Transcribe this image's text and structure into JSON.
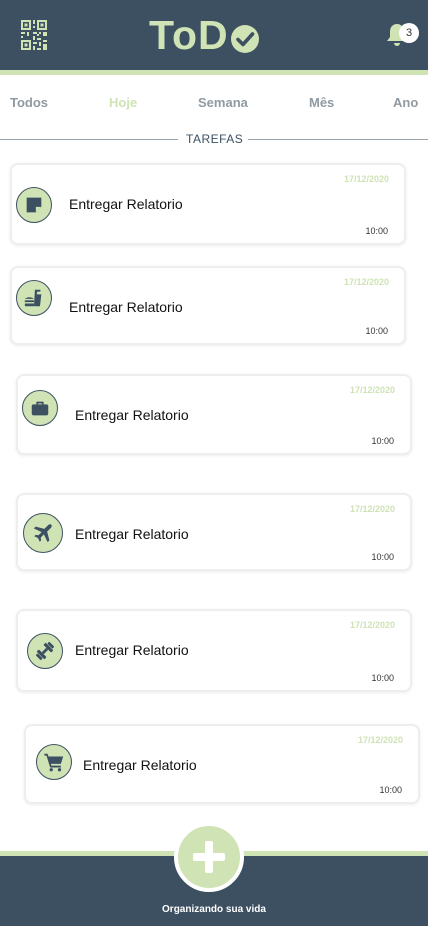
{
  "header": {
    "logo_text": "ToD",
    "notification_count": "3",
    "qr_icon": "qr-code-icon",
    "bell_icon": "bell-icon",
    "check_icon": "check-circle-icon"
  },
  "tabs": [
    {
      "label": "Todos",
      "active": false
    },
    {
      "label": "Hoje",
      "active": true
    },
    {
      "label": "Semana",
      "active": false
    },
    {
      "label": "Mês",
      "active": false
    },
    {
      "label": "Ano",
      "active": false
    }
  ],
  "section": {
    "label": "TAREFAS"
  },
  "tasks": [
    {
      "title": "Entregar Relatorio",
      "date": "17/12/2020",
      "time": "10:00",
      "icon": "note-icon"
    },
    {
      "title": "Entregar Relatorio",
      "date": "17/12/2020",
      "time": "10:00",
      "icon": "food-drink-icon"
    },
    {
      "title": "Entregar Relatorio",
      "date": "17/12/2020",
      "time": "10:00",
      "icon": "briefcase-icon"
    },
    {
      "title": "Entregar Relatorio",
      "date": "17/12/2020",
      "time": "10:00",
      "icon": "airplane-icon"
    },
    {
      "title": "Entregar Relatorio",
      "date": "17/12/2020",
      "time": "10:00",
      "icon": "dumbbell-icon"
    },
    {
      "title": "Entregar Relatorio",
      "date": "17/12/2020",
      "time": "10:00",
      "icon": "shopping-cart-icon"
    }
  ],
  "footer": {
    "text": "Organizando sua vida",
    "add_icon": "plus-icon"
  },
  "colors": {
    "primary": "#3d5062",
    "accent": "#cfe3b5",
    "muted": "#8f9aa2"
  }
}
